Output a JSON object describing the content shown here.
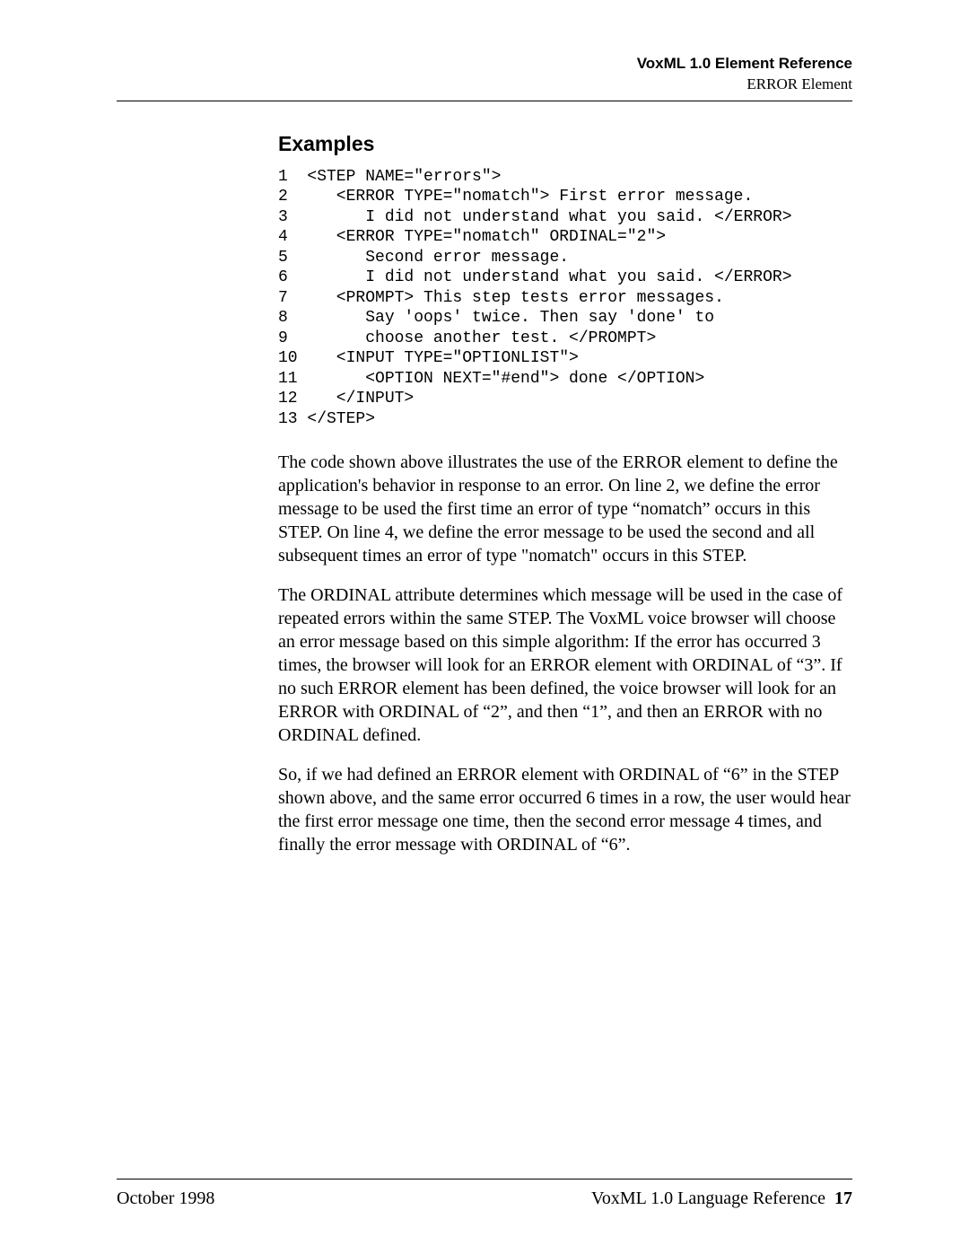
{
  "header": {
    "title": "VoxML 1.0 Element Reference",
    "subtitle": "ERROR Element"
  },
  "section_heading": "Examples",
  "code_lines": [
    "1  <STEP NAME=\"errors\">",
    "2     <ERROR TYPE=\"nomatch\"> First error message.",
    "3        I did not understand what you said. </ERROR>",
    "4     <ERROR TYPE=\"nomatch\" ORDINAL=\"2\">",
    "5        Second error message.",
    "6        I did not understand what you said. </ERROR>",
    "7     <PROMPT> This step tests error messages.",
    "8        Say 'oops' twice. Then say 'done' to",
    "9        choose another test. </PROMPT>",
    "10    <INPUT TYPE=\"OPTIONLIST\">",
    "11       <OPTION NEXT=\"#end\"> done </OPTION>",
    "12    </INPUT>",
    "13 </STEP>"
  ],
  "paragraphs": [
    "The code shown above illustrates the use of the ERROR element to define the application's behavior in response to an error.  On line 2, we define the error message to be used the first time an error of type “nomatch” occurs in this STEP.   On line 4, we define the error message to be used the second and all subsequent times an error of type \"nomatch\" occurs in this STEP.",
    "The ORDINAL attribute determines which message will be used in the case of repeated errors within the same STEP.  The VoxML voice browser will choose an error message based on this simple algorithm: If the error has occurred 3 times, the browser will look for an ERROR element with ORDINAL of “3”.  If no such ERROR element has been defined, the voice browser will look for an ERROR with ORDINAL of “2”, and then “1”, and then an ERROR with no ORDINAL defined.",
    "So, if we had defined an ERROR element with ORDINAL of “6” in the STEP shown above, and the same error occurred 6 times in a row, the user would hear the first error message one time, then the second error message 4 times, and finally the error message with ORDINAL of “6”."
  ],
  "footer": {
    "left": "October 1998",
    "right_text": "VoxML 1.0 Language Reference",
    "page_number": "17"
  }
}
